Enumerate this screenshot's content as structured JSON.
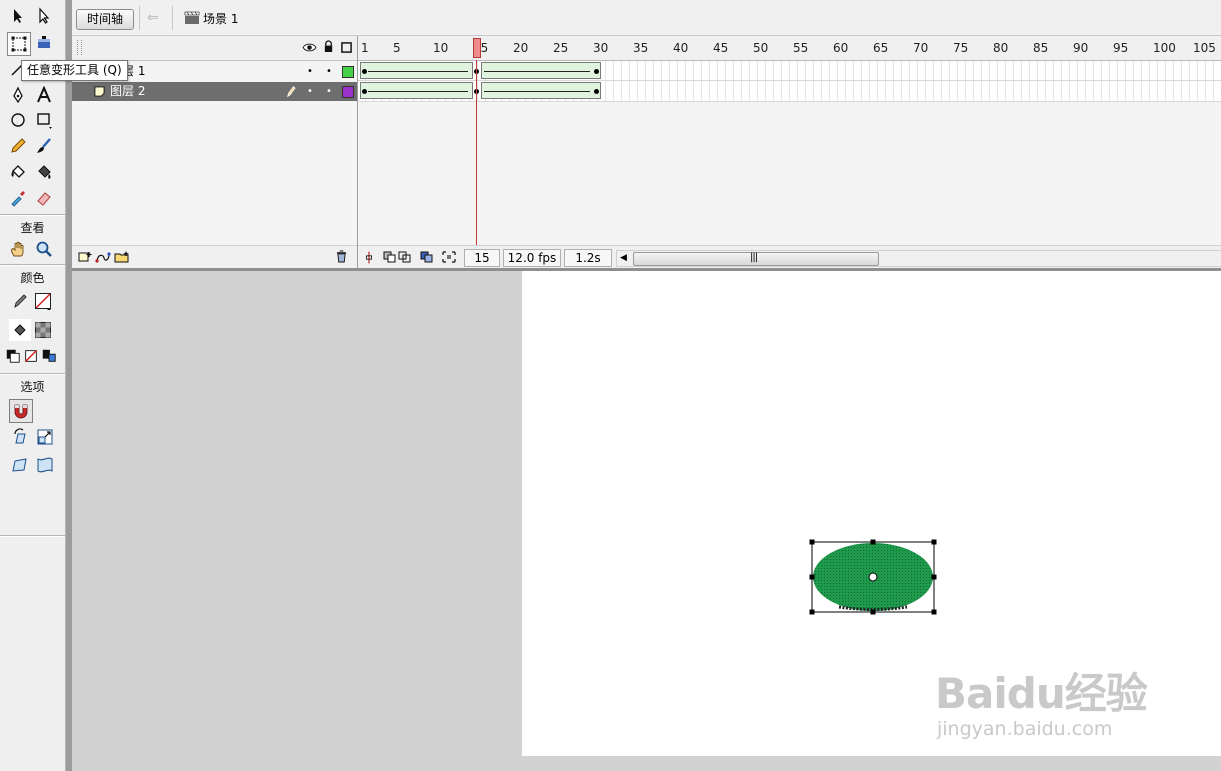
{
  "tooltip": "任意变形工具 (Q)",
  "toolbox": {
    "section_view": "查看",
    "section_colors": "颜色",
    "section_options": "选项"
  },
  "topbar": {
    "timeline_button": "时间轴",
    "scene_label": "场景 1"
  },
  "layers": [
    {
      "name": "图层 1",
      "color": "#46d246",
      "selected": false
    },
    {
      "name": "图层 2",
      "color": "#9b31c8",
      "selected": true
    }
  ],
  "ruler": {
    "ticks": [
      "1",
      "5",
      "10",
      "15",
      "20",
      "25",
      "30",
      "35",
      "40",
      "45",
      "50",
      "55",
      "60",
      "65",
      "70",
      "75",
      "80",
      "85",
      "90",
      "95",
      "100",
      "105"
    ]
  },
  "timeline_status": {
    "current_frame": "15",
    "fps": "12.0 fps",
    "elapsed": "1.2s"
  },
  "colors": {
    "tween": "#dff3df",
    "shape_fill": "#1f9a4c",
    "playhead": "#f08b8b"
  },
  "watermark": {
    "main": "Baidu经验",
    "sub": "jingyan.baidu.com"
  }
}
